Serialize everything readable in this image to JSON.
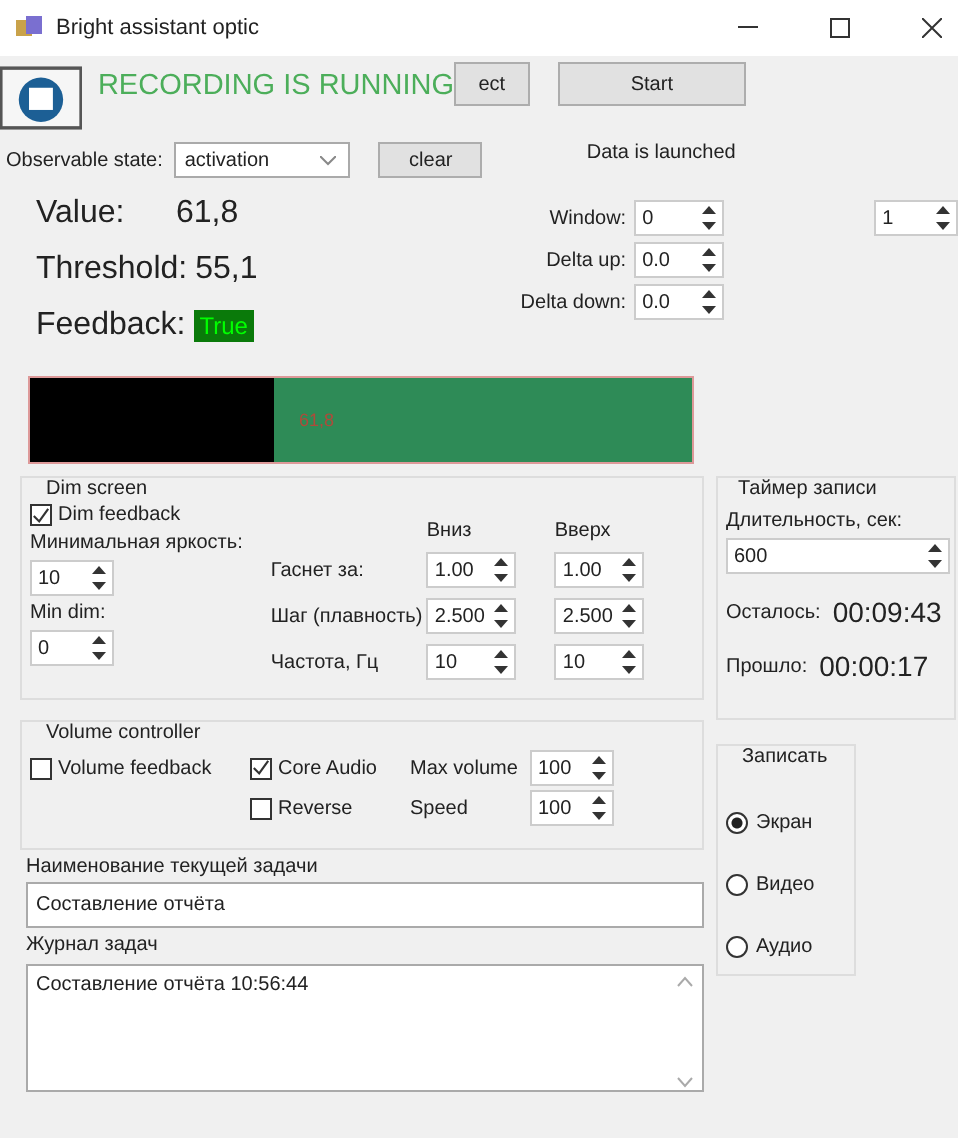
{
  "window": {
    "title": "Bright assistant optic"
  },
  "header": {
    "status": "RECORDING IS RUNNING",
    "buttons": [
      {
        "label": "ect"
      },
      {
        "label": "Start"
      }
    ]
  },
  "observable": {
    "label": "Observable state:",
    "value": "activation",
    "clear": "clear",
    "status": "Data is launched"
  },
  "readings": [
    {
      "label": "Value:",
      "value": "61,8"
    },
    {
      "label": "Threshold:",
      "value": "55,1"
    }
  ],
  "feedback": {
    "label": "Feedback:",
    "value": "True",
    "on": true
  },
  "params": [
    {
      "label": "Window:",
      "value": "0"
    },
    {
      "label": "Delta up:",
      "value": "0.0"
    },
    {
      "label": "Delta down:",
      "value": "0.0"
    }
  ],
  "extra_spin": "1",
  "bar": {
    "level": 0.37,
    "text": "61,8"
  },
  "dim": {
    "title": "Dim screen",
    "checkbox": {
      "label": "Dim feedback",
      "checked": true
    },
    "min_brightness": {
      "label": "Минимальная яркость:",
      "value": "10"
    },
    "min_dim": {
      "label": "Min dim:",
      "value": "0"
    },
    "columns": [
      "Вниз",
      "Вверх"
    ],
    "rows": [
      {
        "label": "Гаснет за:",
        "down": "1.00",
        "up": "1.00"
      },
      {
        "label": "Шаг (плавность)",
        "down": "2.500",
        "up": "2.500"
      },
      {
        "label": "Частота, Гц",
        "down": "10",
        "up": "10"
      }
    ]
  },
  "timer": {
    "title": "Таймер записи",
    "duration_label": "Длительность, сек:",
    "duration": "600",
    "remaining_label": "Осталось:",
    "remaining": "00:09:43",
    "elapsed_label": "Прошло:",
    "elapsed": "00:00:17"
  },
  "volume": {
    "title": "Volume controller",
    "checks": [
      {
        "label": "Volume feedback",
        "checked": false
      },
      {
        "label": "Core Audio",
        "checked": true
      },
      {
        "label": "Reverse",
        "checked": false
      }
    ],
    "spins": [
      {
        "label": "Max volume",
        "value": "100"
      },
      {
        "label": "Speed",
        "value": "100"
      }
    ]
  },
  "record": {
    "title": "Записать",
    "options": [
      {
        "label": "Экран",
        "selected": true
      },
      {
        "label": "Видео",
        "selected": false
      },
      {
        "label": "Аудио",
        "selected": false
      }
    ]
  },
  "task": {
    "label": "Наименование текущей задачи",
    "value": "Составление отчёта"
  },
  "log": {
    "label": "Журнал задач",
    "lines": [
      "Составление отчёта 10:56:44"
    ]
  }
}
